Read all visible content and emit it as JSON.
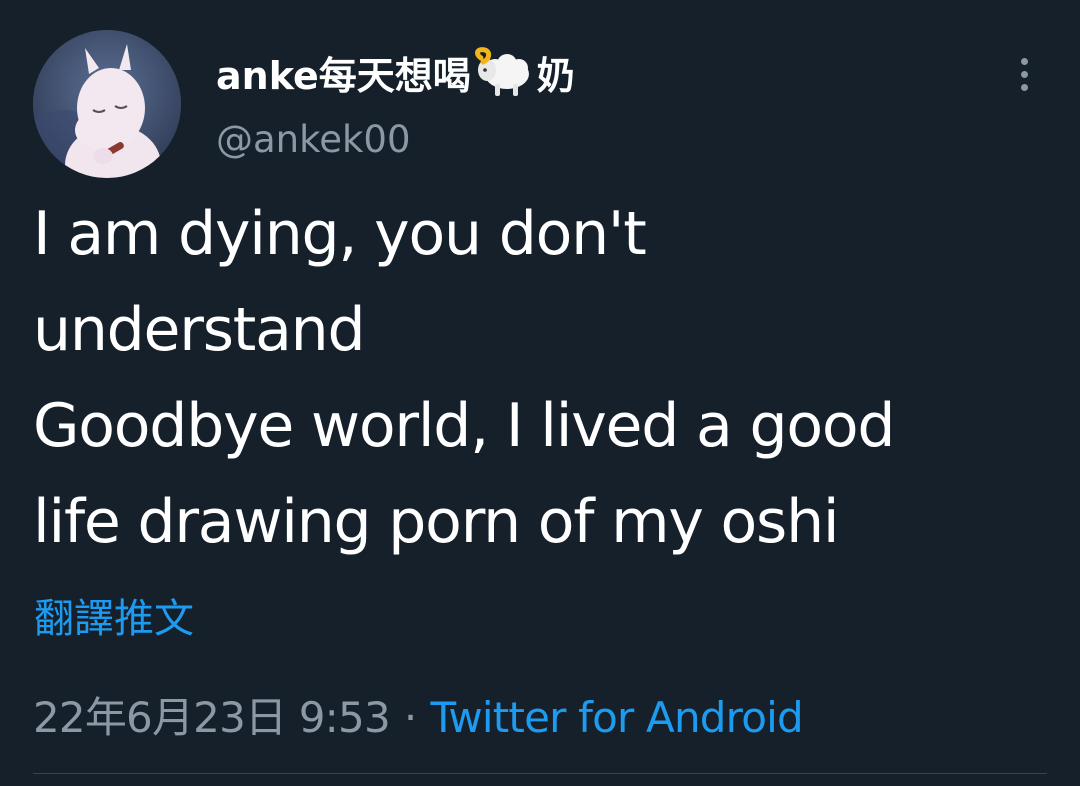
{
  "author": {
    "display_name_prefix": "anke每天想喝",
    "display_name_suffix": "奶",
    "handle": "@ankek00",
    "avatar_icon": "moomin-avatar-icon",
    "name_icon": "ram-emoji-icon"
  },
  "tweet": {
    "lines": [
      "I am dying, you don't",
      "understand",
      "Goodbye world, I lived a good",
      "life drawing porn of my oshi"
    ],
    "translate_label": "翻譯推文"
  },
  "meta": {
    "timestamp": "22年6月23日 9:53",
    "separator": "·",
    "source": "Twitter for Android"
  },
  "colors": {
    "background": "#15202b",
    "accent": "#1d9bf0",
    "secondary_text": "#8b98a5",
    "divider": "#38444d"
  }
}
